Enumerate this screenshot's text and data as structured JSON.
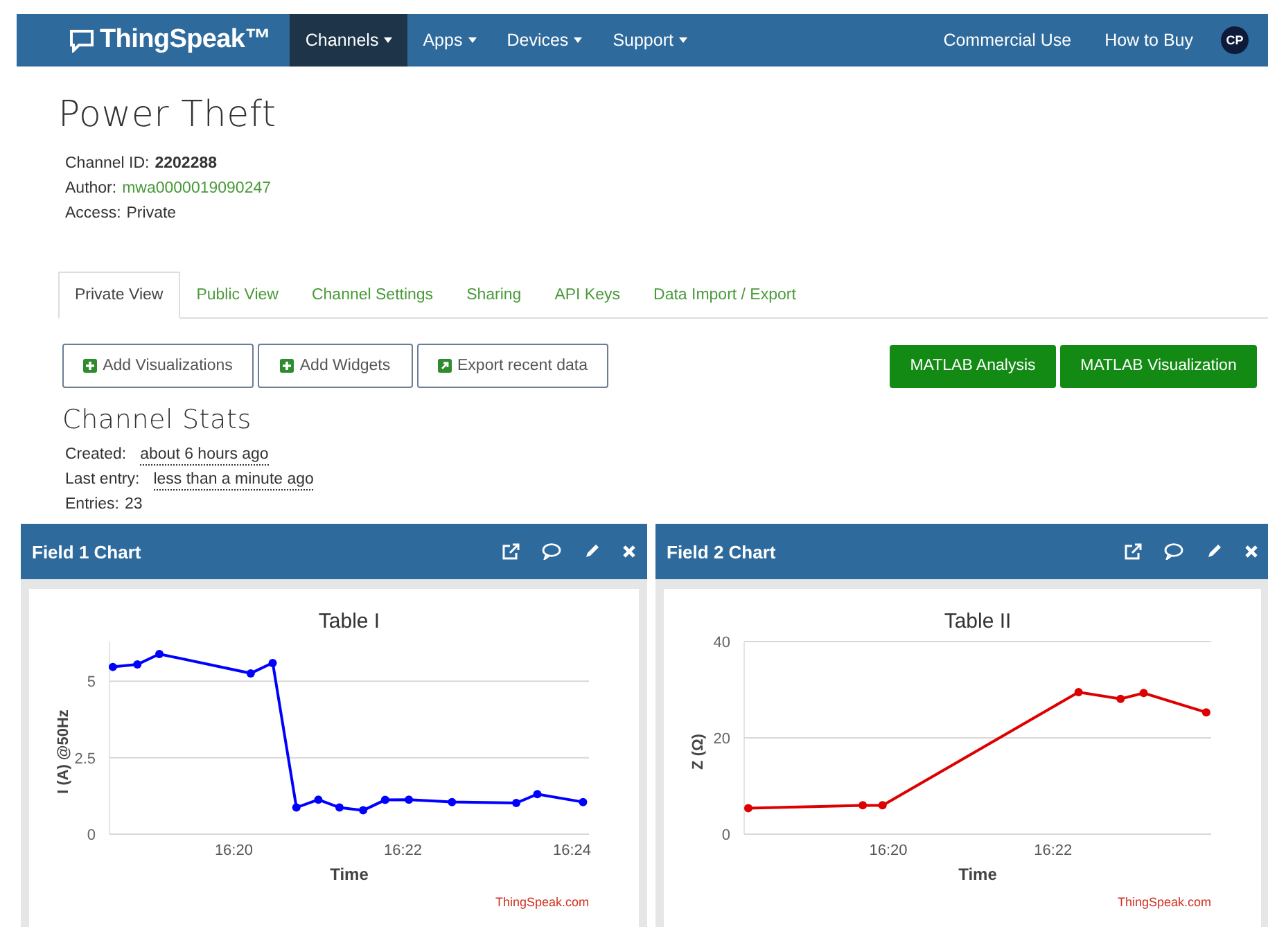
{
  "navbar": {
    "brand": "ThingSpeak™",
    "menu": [
      {
        "label": "Channels",
        "selected": true,
        "dropdown": true
      },
      {
        "label": "Apps",
        "selected": false,
        "dropdown": true
      },
      {
        "label": "Devices",
        "selected": false,
        "dropdown": true
      },
      {
        "label": "Support",
        "selected": false,
        "dropdown": true
      }
    ],
    "right_links": [
      "Commercial Use",
      "How to Buy"
    ],
    "avatar": "CP"
  },
  "channel": {
    "title": "Power Theft",
    "info": [
      {
        "label": "Channel ID:",
        "value": "2202288",
        "kind": "bold"
      },
      {
        "label": "Author:",
        "value": "mwa0000019090247",
        "kind": "link"
      },
      {
        "label": "Access:",
        "value": "Private",
        "kind": "plain"
      }
    ]
  },
  "tabs": [
    {
      "label": "Private View",
      "selected": true
    },
    {
      "label": "Public View",
      "selected": false
    },
    {
      "label": "Channel Settings",
      "selected": false
    },
    {
      "label": "Sharing",
      "selected": false
    },
    {
      "label": "API Keys",
      "selected": false
    },
    {
      "label": "Data Import / Export",
      "selected": false
    }
  ],
  "actions": [
    {
      "label": "Add Visualizations",
      "kind": "add"
    },
    {
      "label": "Add Widgets",
      "kind": "add"
    },
    {
      "label": "Export recent data",
      "kind": "export"
    }
  ],
  "matlab_buttons": [
    "MATLAB Analysis",
    "MATLAB Visualization"
  ],
  "stats": {
    "title": "Channel Stats",
    "rows": [
      {
        "label": "Created:",
        "value": "about 6 hours ago",
        "kind": "time"
      },
      {
        "label": "Last entry:",
        "value": "less than a minute ago",
        "kind": "time"
      },
      {
        "label": "Entries:",
        "value": "23",
        "kind": "plain"
      }
    ]
  },
  "charts": [
    {
      "header": "Field 1 Chart",
      "credit": "ThingSpeak.com",
      "chart_data": {
        "type": "line",
        "title": "Table I",
        "xlabel": "Time",
        "ylabel": "I (A) @50Hz",
        "x": [
          978.57,
          978.86,
          979.12,
          980.2,
          980.46,
          980.74,
          981.0,
          981.25,
          981.53,
          981.79,
          982.07,
          982.58,
          983.34,
          983.59,
          984.13
        ],
        "series": [
          {
            "color": "#0000ff",
            "marker": "circle",
            "values": [
              5.47,
              5.55,
              5.89,
              5.26,
              5.6,
              0.87,
              1.13,
              0.87,
              0.78,
              1.12,
              1.13,
              1.05,
              1.02,
              1.31,
              1.05
            ]
          }
        ],
        "xlim": [
          978.53,
          984.2
        ],
        "ylim": [
          0,
          6.3
        ],
        "xticks": [
          {
            "value": 980,
            "label": "16:20"
          },
          {
            "value": 982,
            "label": "16:22"
          },
          {
            "value": 984,
            "label": "16:24"
          }
        ],
        "yticks": [
          {
            "value": 0,
            "label": "0"
          },
          {
            "value": 2.5,
            "label": "2.5"
          },
          {
            "value": 5,
            "label": "5"
          }
        ]
      }
    },
    {
      "header": "Field 2 Chart",
      "credit": "ThingSpeak.com",
      "chart_data": {
        "type": "line",
        "title": "Table II",
        "xlabel": "Time",
        "ylabel": "Z (Ω)",
        "x": [
          978.3,
          979.69,
          979.93,
          982.31,
          982.82,
          983.1,
          983.86
        ],
        "series": [
          {
            "color": "#dd0000",
            "marker": "circle",
            "values": [
              5.4,
              6.0,
              6.0,
              29.5,
              28.1,
              29.3,
              25.3
            ]
          }
        ],
        "xlim": [
          978.25,
          983.92
        ],
        "ylim": [
          0,
          40
        ],
        "xticks": [
          {
            "value": 980,
            "label": "16:20"
          },
          {
            "value": 982,
            "label": "16:22"
          }
        ],
        "yticks": [
          {
            "value": 0,
            "label": "0"
          },
          {
            "value": 20,
            "label": "20"
          },
          {
            "value": 40,
            "label": "40"
          }
        ]
      }
    }
  ]
}
